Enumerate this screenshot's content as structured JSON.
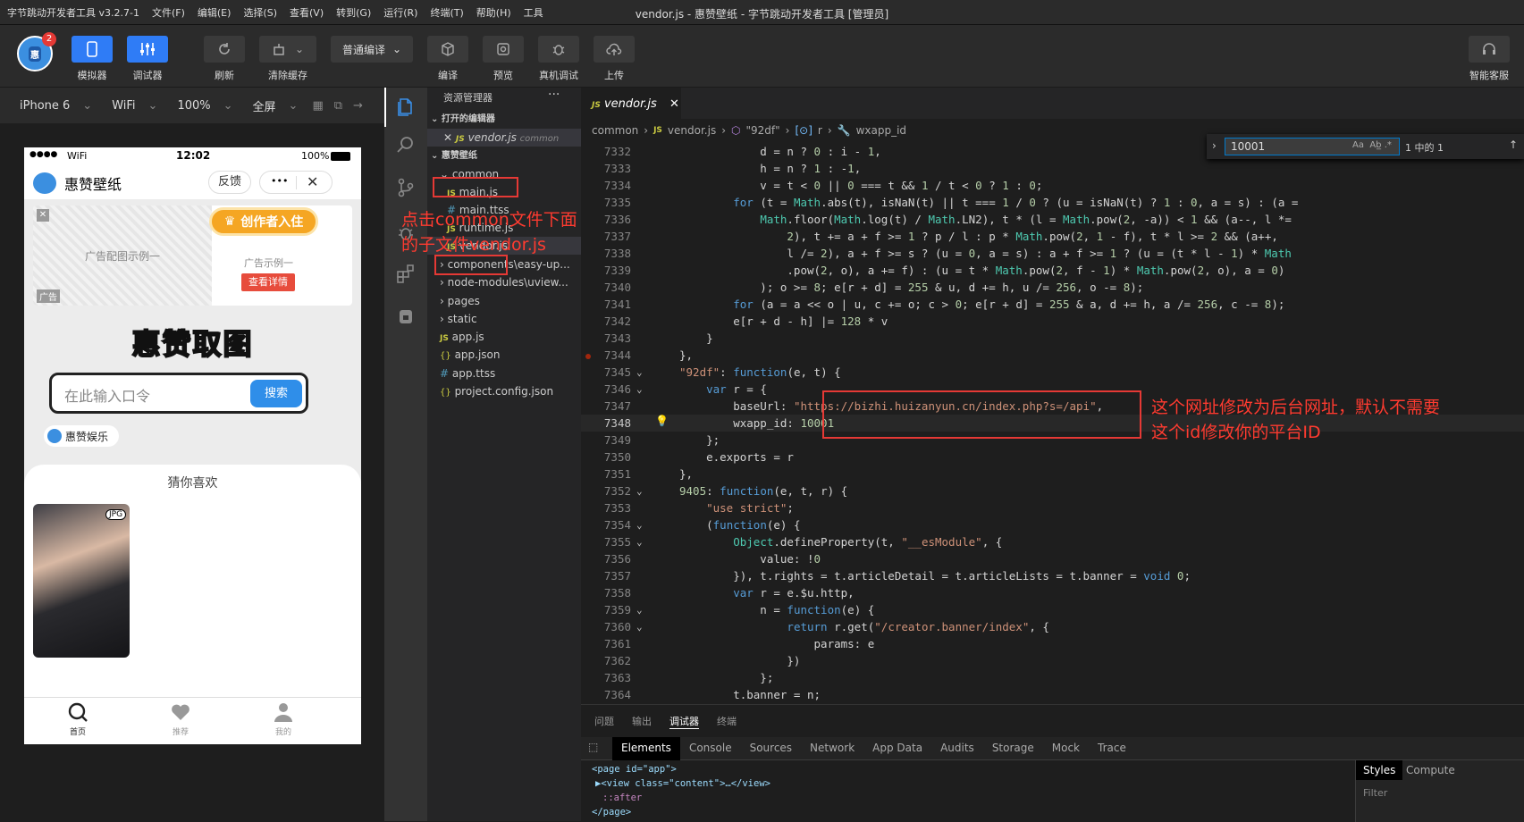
{
  "titlebar": {
    "app_name": "字节跳动开发者工具 v3.2.7-1",
    "menus": [
      "文件(F)",
      "编辑(E)",
      "选择(S)",
      "查看(V)",
      "转到(G)",
      "运行(R)",
      "终端(T)",
      "帮助(H)",
      "工具"
    ],
    "window_title": "vendor.js - 惠赞壁纸 - 字节跳动开发者工具 [管理员]"
  },
  "toolbar": {
    "avatar_badge": "2",
    "simulator": "模拟器",
    "debugger": "调试器",
    "refresh": "刷新",
    "clear_cache": "清除缓存",
    "compile_mode": "普通编译",
    "compile": "编译",
    "preview": "预览",
    "device_debug": "真机调试",
    "upload": "上传",
    "support": "智能客服"
  },
  "devbar": {
    "device": "iPhone 6",
    "network": "WiFi",
    "zoom": "100%",
    "fullscreen": "全屏"
  },
  "phone": {
    "status_dots": "●●●●",
    "status_wifi": "WiFi",
    "status_time": "12:02",
    "status_battery": "100%",
    "app_title": "惠赞壁纸",
    "feedback": "反馈",
    "more": "•••",
    "ad_placeholder": "广告配图示例一",
    "creator_button": "创作者入住",
    "ad_example": "广告示例一",
    "ad_detail": "查看详情",
    "ad_tag": "广告",
    "logo_text": "惠赞取图",
    "search_placeholder": "在此输入口令",
    "search_button": "搜索",
    "entertainment_tag": "惠赞娱乐",
    "guess_like": "猜你喜欢",
    "img_badge": "JPG",
    "tabs": [
      {
        "label": "首页"
      },
      {
        "label": "推荐"
      },
      {
        "label": "我的"
      }
    ]
  },
  "explorer": {
    "header": "资源管理器",
    "open_editors": "打开的编辑器",
    "open_file": "vendor.js",
    "open_file_dir": "common",
    "project": "惠赞壁纸",
    "tree": [
      {
        "label": "common"
      },
      {
        "label": "main.js"
      },
      {
        "label": "main.ttss"
      },
      {
        "label": "runtime.js"
      },
      {
        "label": "vendor.js"
      },
      {
        "label": "components\\easy-up..."
      },
      {
        "label": "node-modules\\uview..."
      },
      {
        "label": "pages"
      },
      {
        "label": "static"
      },
      {
        "label": "app.js"
      },
      {
        "label": "app.json"
      },
      {
        "label": "app.ttss"
      },
      {
        "label": "project.config.json"
      }
    ]
  },
  "annotations": {
    "left": "点击common文件下面的子文件vendor.js",
    "right_line1": "这个网址修改为后台网址，默认不需要",
    "right_line2": "这个id修改你的平台ID"
  },
  "editor": {
    "tab_label": "vendor.js",
    "breadcrumb": [
      "common",
      "vendor.js",
      "\"92df\"",
      "r",
      "wxapp_id"
    ],
    "find_value": "10001",
    "find_result": "1 中的 1",
    "lines": [
      {
        "n": "7332",
        "code": "            d = n ? 0 : i - 1,"
      },
      {
        "n": "7333",
        "code": "            h = n ? 1 : -1,"
      },
      {
        "n": "7334",
        "code": "            v = t < 0 || 0 === t && 1 / t < 0 ? 1 : 0;"
      },
      {
        "n": "7335",
        "code": "        for (t = Math.abs(t), isNaN(t) || t === 1 / 0 ? (u = isNaN(t) ? 1 : 0, a = s) : (a ="
      },
      {
        "n": "7336",
        "code": "            Math.floor(Math.log(t) / Math.LN2), t * (l = Math.pow(2, -a)) < 1 && (a--, l *="
      },
      {
        "n": "7337",
        "code": "                2), t += a + f >= 1 ? p / l : p * Math.pow(2, 1 - f), t * l >= 2 && (a++,"
      },
      {
        "n": "7338",
        "code": "                l /= 2), a + f >= s ? (u = 0, a = s) : a + f >= 1 ? (u = (t * l - 1) * Math"
      },
      {
        "n": "7339",
        "code": "                .pow(2, o), a += f) : (u = t * Math.pow(2, f - 1) * Math.pow(2, o), a = 0)"
      },
      {
        "n": "7340",
        "code": "            ); o >= 8; e[r + d] = 255 & u, d += h, u /= 256, o -= 8);"
      },
      {
        "n": "7341",
        "code": "        for (a = a << o | u, c += o; c > 0; e[r + d] = 255 & a, d += h, a /= 256, c -= 8);"
      },
      {
        "n": "7342",
        "code": "        e[r + d - h] |= 128 * v"
      },
      {
        "n": "7343",
        "code": "    }"
      },
      {
        "n": "7344",
        "code": "},"
      },
      {
        "n": "7345",
        "code": "\"92df\": function(e, t) {"
      },
      {
        "n": "7346",
        "code": "    var r = {"
      },
      {
        "n": "7347",
        "code": "        baseUrl: \"https://bizhi.huizanyun.cn/index.php?s=/api\","
      },
      {
        "n": "7348",
        "code": "        wxapp_id: 10001"
      },
      {
        "n": "7349",
        "code": "    };"
      },
      {
        "n": "7350",
        "code": "    e.exports = r"
      },
      {
        "n": "7351",
        "code": "},"
      },
      {
        "n": "7352",
        "code": "9405: function(e, t, r) {"
      },
      {
        "n": "7353",
        "code": "    \"use strict\";"
      },
      {
        "n": "7354",
        "code": "    (function(e) {"
      },
      {
        "n": "7355",
        "code": "        Object.defineProperty(t, \"__esModule\", {"
      },
      {
        "n": "7356",
        "code": "            value: !0"
      },
      {
        "n": "7357",
        "code": "        }), t.rights = t.articleDetail = t.articleLists = t.banner = void 0;"
      },
      {
        "n": "7358",
        "code": "        var r = e.$u.http,"
      },
      {
        "n": "7359",
        "code": "            n = function(e) {"
      },
      {
        "n": "7360",
        "code": "                return r.get(\"/creator.banner/index\", {"
      },
      {
        "n": "7361",
        "code": "                    params: e"
      },
      {
        "n": "7362",
        "code": "                })"
      },
      {
        "n": "7363",
        "code": "            };"
      },
      {
        "n": "7364",
        "code": "        t.banner = n;"
      }
    ]
  },
  "panel": {
    "tabs": [
      "问题",
      "输出",
      "调试器",
      "终端"
    ],
    "devtools_tabs": [
      "Elements",
      "Console",
      "Sources",
      "Network",
      "App Data",
      "Audits",
      "Storage",
      "Mock",
      "Trace"
    ],
    "dom_lines": [
      "<page id=\"app\">",
      "▶<view class=\"content\">…</view>",
      "::after",
      "</page>"
    ],
    "styles_tab": "Styles",
    "computed_tab": "Compute",
    "filter": "Filter"
  }
}
